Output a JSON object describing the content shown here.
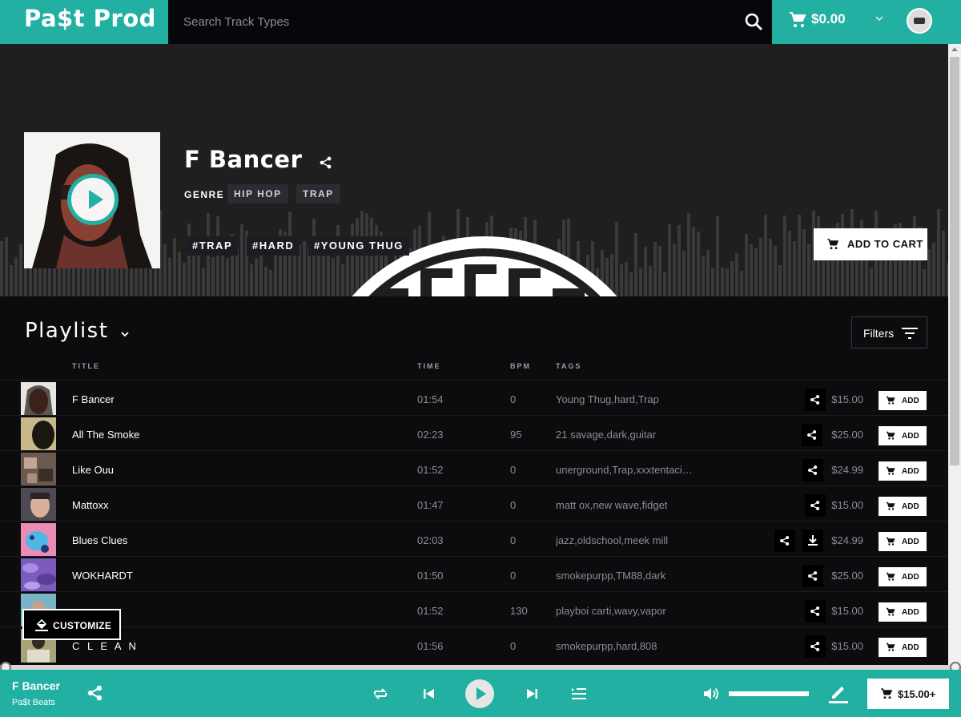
{
  "brand": {
    "logo": "Pa$t Prod"
  },
  "search": {
    "placeholder": "Search Track Types"
  },
  "cart": {
    "total": "$0.00"
  },
  "hero": {
    "title": "F Bancer",
    "genre_label": "GENRE",
    "genres": [
      "HIP HOP",
      "TRAP"
    ],
    "hashtags": [
      "#TRAP",
      "#HARD",
      "#YOUNG THUG"
    ],
    "add_to_cart": "ADD TO CART"
  },
  "playlist": {
    "title": "Playlist",
    "filters_label": "Filters",
    "columns": {
      "title": "TITLE",
      "time": "TIME",
      "bpm": "BPM",
      "tags": "TAGS"
    },
    "add_label": "ADD",
    "rows": [
      {
        "title": "F Bancer",
        "time": "01:54",
        "bpm": "0",
        "tags": "Young Thug,hard,Trap",
        "price": "$15.00"
      },
      {
        "title": "All The Smoke",
        "time": "02:23",
        "bpm": "95",
        "tags": "21 savage,dark,guitar",
        "price": "$25.00"
      },
      {
        "title": "Like Ouu",
        "time": "01:52",
        "bpm": "0",
        "tags": "unerground,Trap,xxxtentaci…",
        "price": "$24.99"
      },
      {
        "title": "Mattoxx",
        "time": "01:47",
        "bpm": "0",
        "tags": "matt ox,new wave,fidget",
        "price": "$15.00"
      },
      {
        "title": "Blues Clues",
        "time": "02:03",
        "bpm": "0",
        "tags": "jazz,oldschool,meek mill",
        "price": "$24.99"
      },
      {
        "title": "WOKHARDT",
        "time": "01:50",
        "bpm": "0",
        "tags": "smokepurpp,TM88,dark",
        "price": "$25.00"
      },
      {
        "title": "",
        "time": "01:52",
        "bpm": "130",
        "tags": "playboi carti,wavy,vapor",
        "price": "$15.00"
      },
      {
        "title": "C L E A N",
        "time": "01:56",
        "bpm": "0",
        "tags": "smokepurpp,hard,808",
        "price": "$15.00"
      }
    ]
  },
  "customize": {
    "label": "CUSTOMIZE"
  },
  "player": {
    "title": "F Bancer",
    "artist": "Pa$t Beats",
    "cart_price": "$15.00+"
  },
  "colors": {
    "accent": "#22b0a3",
    "background": "#0c0c0e",
    "hero_bg": "#1f1f20"
  }
}
